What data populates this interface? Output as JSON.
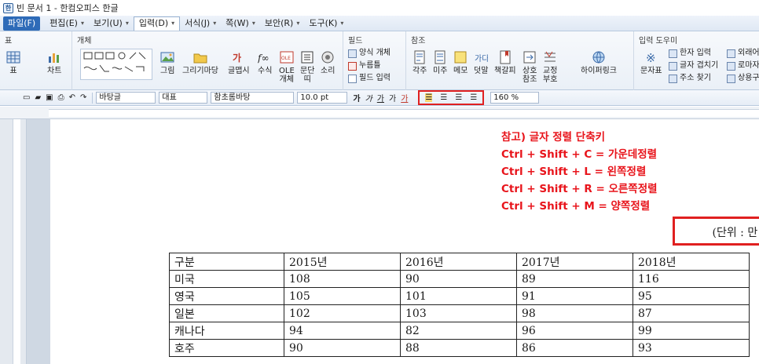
{
  "app": {
    "title": "빈 문서 1 - 한컴오피스 한글"
  },
  "menubar": {
    "items": [
      {
        "label": "파일(F)"
      },
      {
        "label": "편집(E)"
      },
      {
        "label": "보기(U)"
      },
      {
        "label": "입력(D)"
      },
      {
        "label": "서식(J)"
      },
      {
        "label": "쪽(W)"
      },
      {
        "label": "보안(R)"
      },
      {
        "label": "도구(K)"
      }
    ]
  },
  "ribbon": {
    "groups": {
      "table": "표",
      "object": "개체",
      "field": "필드",
      "reference": "참조",
      "input_helper": "입력 도우미"
    },
    "buttons": {
      "table": "표",
      "chart": "차트",
      "picture": "그림",
      "drawing_mart": "그리기마당",
      "word_art": "글맵시",
      "formula": "수식",
      "ole_line1": "OLE",
      "ole_line2": "개체",
      "paragraph_line1": "문단",
      "paragraph_line2": "띠",
      "sound": "소리",
      "form_object": "양식 개체",
      "pushbutton": "누름틀",
      "field_input": "필드 입력",
      "footnote": "각주",
      "endnote": "미주",
      "memo": "메모",
      "overlay": "덧말",
      "bookmark": "책갈피",
      "cross_ref_line1": "상호",
      "cross_ref_line2": "참조",
      "proofread_line1": "교정",
      "proofread_line2": "부호",
      "hyperlink": "하이퍼링크",
      "symbol_table": "문자표",
      "hanja_input": "한자 입력",
      "glyph_overlap": "글자 겹치기",
      "address_search": "주소 찾기",
      "foreign_word": "외래어",
      "romanization": "로마자",
      "common_words": "상용구"
    }
  },
  "toolbar": {
    "style": "바탕글",
    "language": "대표",
    "font": "함초롬바탕",
    "font_size": "10.0",
    "size_unit": "pt",
    "bold": "가",
    "italic": "가",
    "underline": "가",
    "strike": "가",
    "color": "가",
    "line_spacing": "160",
    "line_spacing_unit": "%"
  },
  "note": {
    "lines": [
      "참고) 글자 정렬 단축키",
      "Ctrl + Shift + C = 가운데정렬",
      "Ctrl + Shift + L = 왼쪽정렬",
      "Ctrl + Shift + R = 오른쪽정렬",
      "Ctrl + Shift + M = 양쪽정렬"
    ]
  },
  "unit_label": "(단위 : 만 명)",
  "table": {
    "header": [
      "구분",
      "2015년",
      "2016년",
      "2017년",
      "2018년"
    ],
    "rows": [
      [
        "미국",
        "108",
        "90",
        "89",
        "116"
      ],
      [
        "영국",
        "105",
        "101",
        "91",
        "95"
      ],
      [
        "일본",
        "102",
        "103",
        "98",
        "87"
      ],
      [
        "캐나다",
        "94",
        "82",
        "96",
        "99"
      ],
      [
        "호주",
        "90",
        "88",
        "86",
        "93"
      ]
    ]
  },
  "colors": {
    "accent": "#2e6bb8",
    "highlight_red": "#e02020",
    "note_red": "#e8141b"
  }
}
